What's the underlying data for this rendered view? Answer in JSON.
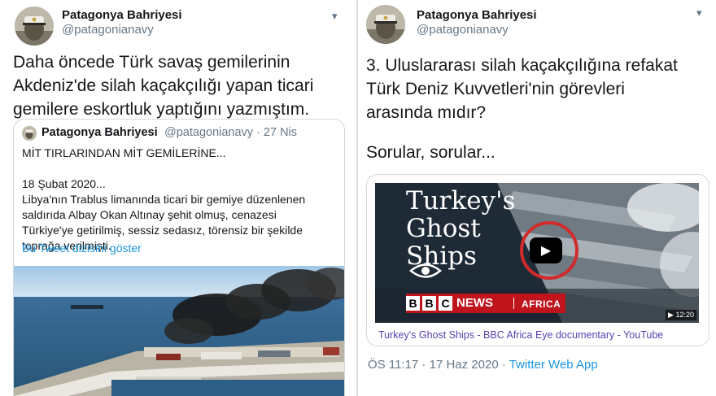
{
  "left": {
    "user": {
      "name": "Patagonya Bahriyesi",
      "handle": "@patagonianavy"
    },
    "menu_icon": "chevron-down-icon",
    "text_lines": [
      "Daha öncede Türk savaş gemilerinin",
      "Akdeniz'de silah kaçakçılığı yapan ticari",
      "gemilere eskortluk yaptığını yazmıştım."
    ],
    "quote": {
      "name": "Patagonya Bahriyesi",
      "meta": "@patagonianavy · 27 Nis",
      "lines": [
        "MİT TIRLARINDAN MİT GEMİLERİNE...",
        "",
        "18 Şubat 2020...",
        "Libya'nın Trablus limanında ticari bir gemiye düzenlenen",
        "saldırıda Albay Okan Altınay şehit olmuş, cenazesi",
        "Türkiye'ye getirilmiş, sessiz sedasız, törensiz bir şekilde",
        "toprağa verilmişti."
      ],
      "thread_link": "Bu Tweet dizisini göster"
    }
  },
  "right": {
    "user": {
      "name": "Patagonya Bahriyesi",
      "handle": "@patagonianavy"
    },
    "menu_icon": "chevron-down-icon",
    "text_lines": [
      "3. Uluslararası silah kaçakçılığına refakat",
      "Türk Deniz Kuvvetleri'nin görevleri",
      "arasında mıdır?",
      "",
      "Sorular, sorular..."
    ],
    "video": {
      "title_lines": [
        "Turkey's",
        "Ghost",
        "Ships"
      ],
      "bbc_letters": [
        "B",
        "B",
        "C"
      ],
      "news": "NEWS",
      "africa": "AFRICA",
      "duration": "12:20",
      "caption": "Turkey's Ghost Ships - BBC Africa Eye documentary - YouTube"
    },
    "footer": {
      "time": "ÖS 11:17 · 17 Haz 2020 · ",
      "app": "Twitter Web App"
    }
  },
  "colors": {
    "link": "#1b95e0",
    "text": "#14171a",
    "muted": "#657786",
    "bbc_red": "#c0141c",
    "play_ring": "#d12b2b"
  }
}
